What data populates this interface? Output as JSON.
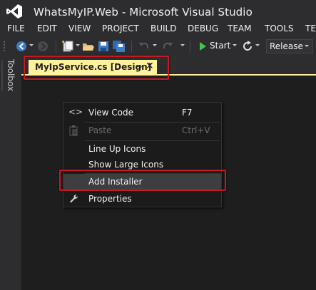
{
  "window": {
    "title": "WhatsMyIP.Web - Microsoft Visual Studio"
  },
  "menu": [
    "FILE",
    "EDIT",
    "VIEW",
    "PROJECT",
    "BUILD",
    "DEBUG",
    "TEAM",
    "TOOLS",
    "TES"
  ],
  "toolbar": {
    "start_label": "Start",
    "configuration": "Release"
  },
  "toolbox": {
    "label": "Toolbox"
  },
  "document_tab": {
    "label": "MyIpService.cs [Design]",
    "pin_glyph": "⊸",
    "close_glyph": "✕"
  },
  "context_menu": {
    "items": [
      {
        "icon": "code-icon",
        "label": "View Code",
        "shortcut": "F7",
        "enabled": true
      },
      {
        "icon": "paste-icon",
        "label": "Paste",
        "shortcut": "Ctrl+V",
        "enabled": false
      },
      {
        "icon": "",
        "label": "Line Up Icons",
        "shortcut": "",
        "enabled": true
      },
      {
        "icon": "",
        "label": "Show Large Icons",
        "shortcut": "",
        "enabled": true
      },
      {
        "icon": "",
        "label": "Add Installer",
        "shortcut": "",
        "enabled": true,
        "highlighted": true
      },
      {
        "icon": "wrench-icon",
        "label": "Properties",
        "shortcut": "",
        "enabled": true
      }
    ]
  },
  "colors": {
    "accent_tab": "#fff29d",
    "highlight_border": "#c41a22",
    "background": "#2d2d30",
    "canvas": "#1e1e1e"
  }
}
